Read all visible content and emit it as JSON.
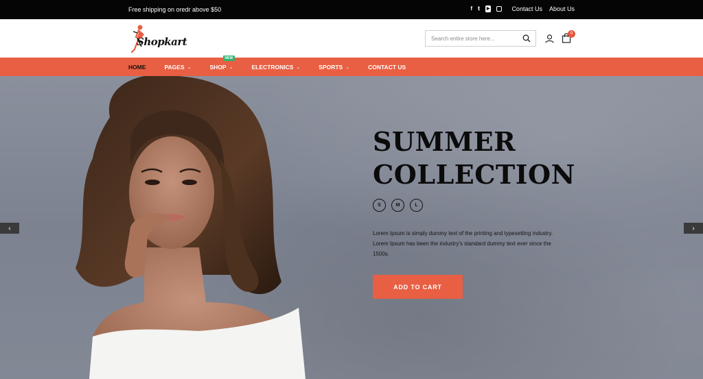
{
  "topbar": {
    "shipping": "Free shipping on oredr above $50",
    "social": [
      "facebook-icon",
      "twitter-icon",
      "youtube-icon",
      "instagram-icon"
    ],
    "contact_label": "Contact Us",
    "about_label": "About Us"
  },
  "header": {
    "logo_text": "Shopkart",
    "search_placeholder": "Search entire store here...",
    "cart_count": "0"
  },
  "nav": {
    "items": [
      {
        "label": "HOME"
      },
      {
        "label": "PAGES"
      },
      {
        "label": "SHOP",
        "badge": "NEW"
      },
      {
        "label": "ELECTRONICS"
      },
      {
        "label": "SPORTS"
      },
      {
        "label": "CONTACT US"
      }
    ]
  },
  "hero": {
    "title_line1": "SUMMER",
    "title_line2": "COLLECTION",
    "sizes": [
      "S",
      "M",
      "L"
    ],
    "description": "Lorem Ipsum is simply dummy text of the printing and typesetting industry. Lorem Ipsum has been the industry's standard dummy text ever since the 1500s.",
    "cta_label": "ADD TO CART"
  },
  "colors": {
    "accent": "#e85f43",
    "topbar_bg": "#050505",
    "badge_green": "#2fb46e"
  }
}
